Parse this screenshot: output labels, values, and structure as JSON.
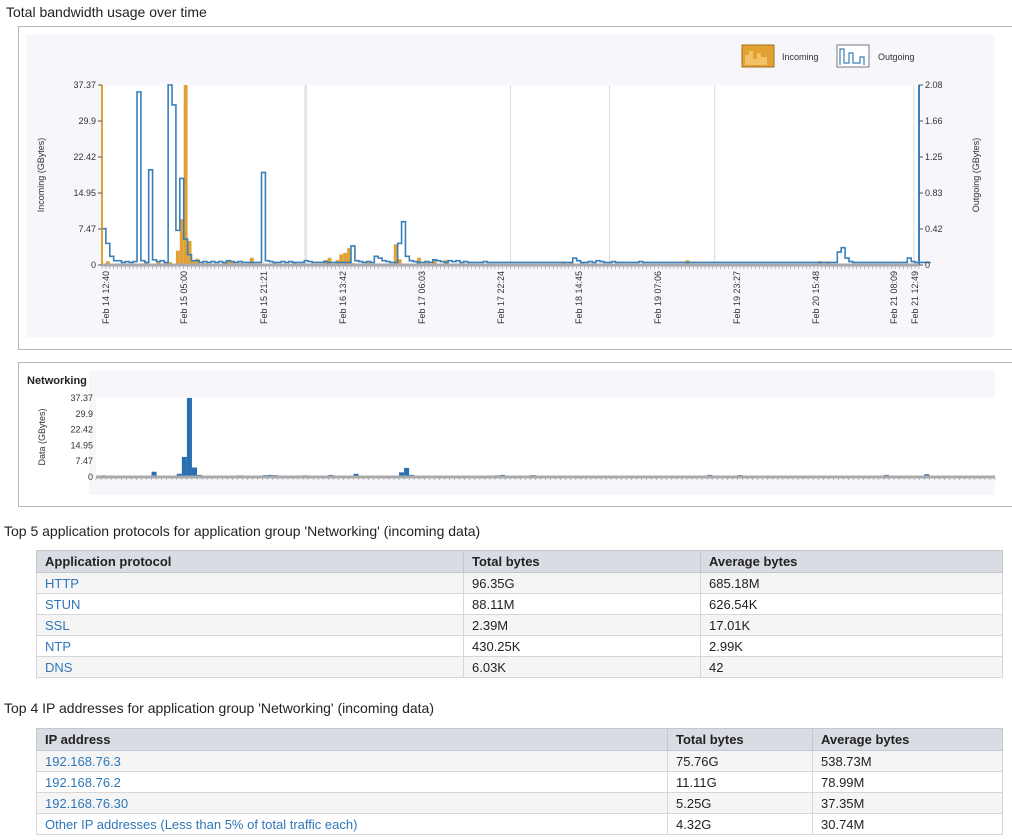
{
  "bandwidth": {
    "title": "Total bandwidth usage over time",
    "legend": {
      "incoming": "Incoming",
      "outgoing": "Outgoing"
    },
    "colors": {
      "incoming": "#e2a233",
      "outgoing": "#3a7fb8",
      "grid": "#d9d9e0"
    },
    "chart_data": {
      "type": "bar",
      "left_axis": {
        "label": "Incoming (GBytes)",
        "ticks": [
          "37.37",
          "29.9",
          "22.42",
          "14.95",
          "7.47",
          "0"
        ]
      },
      "right_axis": {
        "label": "Outgoing (GBytes)",
        "ticks": [
          "2.08",
          "1.66",
          "1.25",
          "0.83",
          "0.42",
          "0"
        ]
      },
      "x_ticks": [
        "Feb 14 12:40",
        "Feb 15 05:00",
        "Feb 15 21:21",
        "Feb 16 13:42",
        "Feb 17 06:03",
        "Feb 17 22:24",
        "Feb 18 14:45",
        "Feb 19 07:06",
        "Feb 19 23:27",
        "Feb 20 15:48",
        "Feb 21 08:09",
        "Feb 21 12:49"
      ],
      "ylim_incoming": [
        0,
        37.37
      ],
      "ylim_outgoing": [
        0,
        2.08
      ],
      "incoming": [
        0,
        0.8,
        0.3,
        0.2,
        0.3,
        0.1,
        0.3,
        0.3,
        0.1,
        0.2,
        0.1,
        0.6,
        0.1,
        0.3,
        0.6,
        0.2,
        0.5,
        0.6,
        0.2,
        3,
        9.5,
        37.37,
        5,
        1,
        1.3,
        0.3,
        0.4,
        0.2,
        0.3,
        0.3,
        0.3,
        0.5,
        0.7,
        0.6,
        0.3,
        0.4,
        0.3,
        0.3,
        1.5,
        0.2,
        0.2,
        0.2,
        0.2,
        0.2,
        0.4,
        0.2,
        0.2,
        0.1,
        0.2,
        0.6,
        0.3,
        0.1,
        0.3,
        0.1,
        0.3,
        0.1,
        0.2,
        1,
        1.5,
        0.2,
        1,
        2.2,
        2.5,
        3.5,
        0.4,
        0.3,
        0.1,
        0.2,
        0.5,
        0.2,
        0.2,
        0.1,
        0.3,
        0.2,
        0.1,
        4.3,
        1.2,
        0.2,
        0.3,
        0.3,
        0.1,
        1.5,
        0.3,
        0.5,
        0.3,
        1,
        0.2,
        0.3,
        1,
        0.1,
        0.1,
        0.2,
        0.1,
        0.2,
        0.2,
        0.2,
        0.1,
        0.2,
        0.3,
        0.1,
        0.1,
        0.1,
        0.2,
        0.1,
        0.2,
        0.1,
        0.1,
        0.1,
        0.1,
        0.3,
        0.1,
        0.2,
        0.1,
        0.1,
        0.3,
        0.1,
        0.1,
        0.2,
        0.6,
        0.1,
        0.6,
        0.3,
        0.2,
        0.4,
        0.1,
        0.2,
        0.2,
        0.1,
        0.1,
        0.2,
        0.1,
        0.1,
        0.1,
        0.2,
        0.1,
        0.1,
        0.2,
        0.1,
        0.3,
        0.1,
        0.1,
        0.1,
        0.1,
        0.2,
        0.1,
        0.1,
        0.1,
        0.1,
        0.1,
        0.1,
        1,
        0.1,
        0.2,
        0.1,
        0.1,
        0.1,
        0.1,
        0.1,
        0.1,
        0.1,
        0.1,
        0.2,
        0.1,
        0.2,
        0.1,
        0.1,
        0.1,
        0.1,
        0.1,
        0.1,
        0.2,
        0.1,
        0.1,
        0.1,
        0.1,
        0.1,
        0.1,
        0.1,
        0.1,
        0.1,
        0.1,
        0.1,
        0.2,
        0.1,
        0.8,
        0.1,
        0.4,
        0.1,
        0.2,
        0.1,
        0.1,
        0.1,
        0.1,
        0.1,
        0.1,
        0.2,
        0.1,
        0.1,
        0.1,
        0.1,
        0.1,
        0.1,
        0.1,
        0.1,
        0.1,
        0.3,
        0.1,
        0.2,
        0.1,
        0.1
      ],
      "outgoing": [
        0.42,
        0.25,
        0.1,
        0.05,
        0.05,
        0.03,
        0.04,
        0.03,
        0.04,
        2,
        0.05,
        0.03,
        1.1,
        0.06,
        0.04,
        0.05,
        0.03,
        2.08,
        1.85,
        0.4,
        1,
        0.3,
        0.12,
        0.05,
        0.05,
        0.03,
        0.04,
        0.03,
        0.04,
        0.03,
        0.04,
        0.03,
        0.05,
        0.04,
        0.03,
        0.04,
        0.03,
        0.03,
        0.03,
        0.03,
        0.03,
        1.07,
        0.05,
        0.04,
        0.03,
        0.03,
        0.04,
        0.03,
        0.04,
        0.03,
        0.03,
        0.03,
        0.05,
        0.04,
        0.03,
        0.03,
        0.03,
        0.04,
        0.03,
        0.03,
        0.03,
        0.03,
        0.03,
        0.03,
        0.22,
        0.05,
        0.04,
        0.03,
        0.04,
        0.03,
        0.1,
        0.08,
        0.05,
        0.04,
        0.03,
        0.03,
        0.25,
        0.5,
        0.1,
        0.05,
        0.04,
        0.03,
        0.03,
        0.04,
        0.03,
        0.06,
        0.05,
        0.04,
        0.03,
        0.05,
        0.04,
        0.05,
        0.03,
        0.04,
        0.03,
        0.03,
        0.03,
        0.03,
        0.04,
        0.03,
        0.03,
        0.03,
        0.03,
        0.03,
        0.03,
        0.03,
        0.03,
        0.03,
        0.03,
        0.03,
        0.03,
        0.03,
        0.03,
        0.03,
        0.03,
        0.03,
        0.03,
        0.03,
        0.03,
        0.03,
        0.03,
        0.08,
        0.05,
        0.03,
        0.03,
        0.04,
        0.03,
        0.05,
        0.04,
        0.03,
        0.03,
        0.04,
        0.03,
        0.03,
        0.03,
        0.03,
        0.03,
        0.03,
        0.04,
        0.03,
        0.03,
        0.03,
        0.03,
        0.03,
        0.03,
        0.03,
        0.03,
        0.03,
        0.03,
        0.03,
        0.03,
        0.03,
        0.03,
        0.03,
        0.03,
        0.03,
        0.03,
        0.03,
        0.03,
        0.03,
        0.03,
        0.03,
        0.03,
        0.03,
        0.03,
        0.03,
        0.03,
        0.03,
        0.03,
        0.03,
        0.03,
        0.03,
        0.03,
        0.03,
        0.03,
        0.03,
        0.03,
        0.03,
        0.03,
        0.03,
        0.03,
        0.03,
        0.03,
        0.03,
        0.03,
        0.03,
        0.03,
        0.03,
        0.03,
        0.15,
        0.2,
        0.08,
        0.04,
        0.03,
        0.03,
        0.03,
        0.03,
        0.03,
        0.03,
        0.03,
        0.03,
        0.03,
        0.03,
        0.03,
        0.03,
        0.03,
        0.03,
        0.08,
        0.04,
        0.03,
        0.03,
        0.03,
        0.03
      ]
    }
  },
  "networking": {
    "title": "Networking",
    "color": "#2a6fb0",
    "chart_data": {
      "type": "bar",
      "y_axis": {
        "label": "Data (GBytes)",
        "ticks": [
          "37.37",
          "29.9",
          "22.42",
          "14.95",
          "7.47",
          "0"
        ]
      },
      "ylim": [
        0,
        37.37
      ],
      "values": [
        0.3,
        0.8,
        0.6,
        0.5,
        0.4,
        0.3,
        0.6,
        0.4,
        0.3,
        0.5,
        0.3,
        2.5,
        0.6,
        0.5,
        0.6,
        0.3,
        1.5,
        9.5,
        37.37,
        4.5,
        1,
        0.6,
        0.5,
        0.4,
        0.3,
        0.3,
        0.4,
        0.3,
        0.8,
        0.3,
        0.3,
        0.4,
        0.3,
        0.9,
        1,
        0.9,
        0.5,
        0.5,
        0.4,
        0.3,
        0.3,
        0.8,
        0.4,
        0.4,
        0.3,
        0.5,
        1,
        0.4,
        0.3,
        0.5,
        0.3,
        1.5,
        0.3,
        0.4,
        0.3,
        0.3,
        0.5,
        0.3,
        0.7,
        0.7,
        2.2,
        4.3,
        1,
        0.4,
        0.4,
        0.3,
        0.5,
        0.4,
        0.3,
        0.3,
        0.6,
        0.5,
        0.3,
        0.3,
        0.6,
        0.3,
        0.4,
        0.3,
        0.3,
        0.8,
        1,
        0.6,
        0.4,
        0.3,
        0.4,
        0.6,
        0.9,
        0.3,
        0.3,
        0.5,
        0.4,
        0.3,
        0.3,
        0.6,
        0.4,
        0.3,
        0.4,
        0.3,
        0.3,
        0.4,
        0.6,
        0.5,
        0.3,
        0.4,
        0.3,
        0.3,
        0.3,
        0.3,
        0.4,
        0.3,
        0.3,
        0.3,
        0.4,
        0.3,
        0.3,
        0.3,
        0.3,
        0.3,
        0.3,
        0.3,
        0.3,
        1,
        0.6,
        0.4,
        0.3,
        0.3,
        0.3,
        0.9,
        0.3,
        0.3,
        0.3,
        0.3,
        0.3,
        0.3,
        0.3,
        0.3,
        0.3,
        0.3,
        0.3,
        0.3,
        0.3,
        0.3,
        0.3,
        0.3,
        0.3,
        0.3,
        0.3,
        0.3,
        0.3,
        0.3,
        0.3,
        0.3,
        0.3,
        0.3,
        0.3,
        0.3,
        1,
        0.3,
        0.3,
        0.3,
        0.3,
        0.3,
        0.3,
        0.3,
        1.3,
        0.3,
        0.3,
        0.3,
        0.3,
        0.3,
        0.3,
        0.3,
        0.3,
        0.3,
        0.3,
        0.3,
        0.3,
        0.3
      ]
    }
  },
  "protocols": {
    "title": "Top 5 application protocols for application group 'Networking' (incoming data)",
    "headers": [
      "Application protocol",
      "Total bytes",
      "Average bytes"
    ],
    "rows": [
      [
        "HTTP",
        "96.35G",
        "685.18M"
      ],
      [
        "STUN",
        "88.11M",
        "626.54K"
      ],
      [
        "SSL",
        "2.39M",
        "17.01K"
      ],
      [
        "NTP",
        "430.25K",
        "2.99K"
      ],
      [
        "DNS",
        "6.03K",
        "42"
      ]
    ]
  },
  "ips": {
    "title": "Top 4 IP addresses for application group 'Networking' (incoming data)",
    "headers": [
      "IP address",
      "Total bytes",
      "Average bytes"
    ],
    "rows": [
      [
        "192.168.76.3",
        "75.76G",
        "538.73M"
      ],
      [
        "192.168.76.2",
        "11.11G",
        "78.99M"
      ],
      [
        "192.168.76.30",
        "5.25G",
        "37.35M"
      ],
      [
        "Other IP addresses (Less than 5% of total traffic each)",
        "4.32G",
        "30.74M"
      ]
    ]
  }
}
